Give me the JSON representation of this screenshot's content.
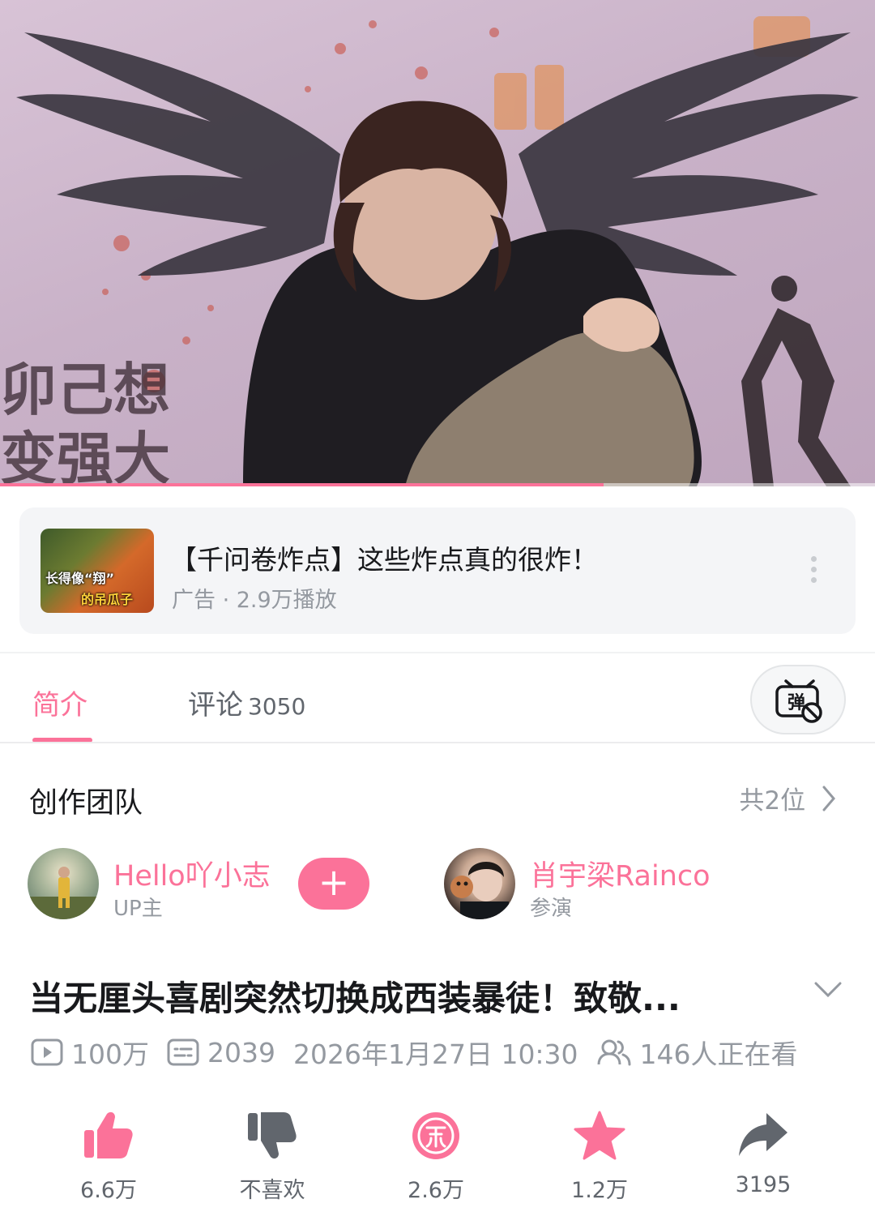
{
  "video": {
    "progress_percent": 69
  },
  "ad": {
    "thumb_caption_line1": "长得像“翔”",
    "thumb_caption_line2": "的吊瓜子",
    "title": "【千问卷炸点】这些炸点真的很炸！",
    "meta": "广告 · 2.9万播放"
  },
  "tabs": {
    "intro": "简介",
    "comments_label": "评论",
    "comments_count": "3050",
    "danmaku_icon_glyph": "弹"
  },
  "team": {
    "title": "创作团队",
    "count": "共2位",
    "members": [
      {
        "name": "Hello吖小志",
        "role": "UP主"
      },
      {
        "name": "肖宇梁Rainco",
        "role": "参演"
      }
    ],
    "follow_glyph": "+"
  },
  "title": {
    "text": "当无厘头喜剧突然切换成西装暴徒！致敬..."
  },
  "stats": {
    "views": "100万",
    "danmaku": "2039",
    "datetime": "2026年1月27日 10:30",
    "watching": "146人正在看"
  },
  "actions": {
    "like": "6.6万",
    "dislike": "不喜欢",
    "coin": "2.6万",
    "favorite": "1.2万",
    "share": "3195"
  },
  "colors": {
    "accent": "#fb7299",
    "text_primary": "#18191c",
    "text_secondary": "#9499a0",
    "icon_dark": "#61666d"
  },
  "icons": {
    "views": "play-box-icon",
    "danmaku": "danmaku-list-icon",
    "watching": "users-icon",
    "like": "thumb-up-icon",
    "dislike": "thumb-down-icon",
    "coin": "coin-icon",
    "favorite": "star-icon",
    "share": "share-arrow-icon",
    "more": "more-vertical-icon",
    "expand": "chevron-down-icon",
    "team_more": "chevron-right-icon",
    "danmaku_toggle": "danmaku-off-icon"
  }
}
